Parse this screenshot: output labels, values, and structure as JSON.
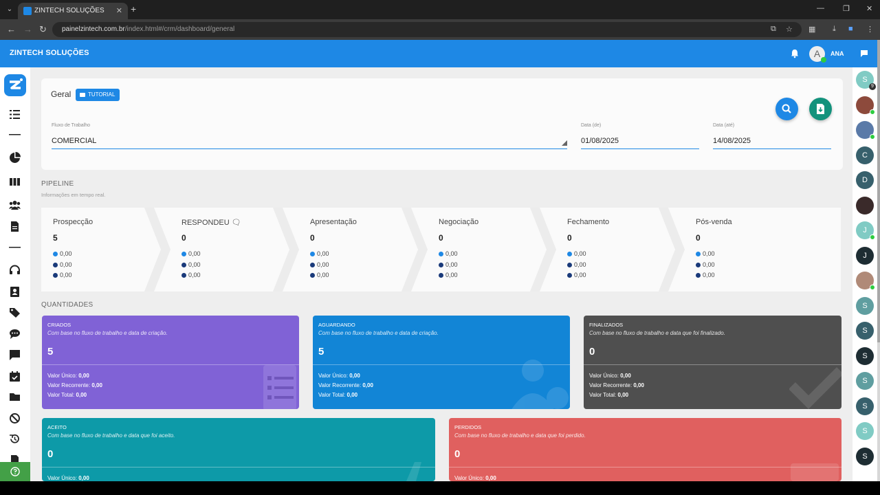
{
  "browser": {
    "tab_title": "ZINTECH SOLUÇÕES",
    "tab_close": "✕",
    "new_tab": "+",
    "url_host": "painelzintech.com.br",
    "url_path": "/index.html#/crm/dashboard/general"
  },
  "app": {
    "brand": "ZINTECH SOLUÇÕES",
    "user_initial": "A",
    "user_name": "ANA",
    "accent_color": "#1e88e5"
  },
  "sidebar_icons": [
    "tasks-icon",
    "divider",
    "pie-chart-icon",
    "kanban-icon",
    "users-icon",
    "document-icon",
    "divider",
    "headset-icon",
    "contacts-icon",
    "tags-icon",
    "chat-icon",
    "message-icon",
    "calendar-check-icon",
    "folder-icon",
    "block-icon",
    "history-icon",
    "file-icon"
  ],
  "filters": {
    "breadcrumb": "Geral",
    "tutorial_label": "TUTORIAL",
    "workflow_label": "Fluxo de Trabalho",
    "workflow_value": "COMERCIAL",
    "date_from_label": "Data (de)",
    "date_from_value": "01/08/2025",
    "date_to_label": "Data (até)",
    "date_to_value": "14/08/2025"
  },
  "pipeline": {
    "title": "PIPELINE",
    "subtitle": "Informações em tempo real.",
    "stages": [
      {
        "name": "Prospecção",
        "count": "5",
        "values": [
          "0,00",
          "0,00",
          "0,00"
        ]
      },
      {
        "name": "RESPONDEU 🗨",
        "count": "0",
        "values": [
          "0,00",
          "0,00",
          "0,00"
        ]
      },
      {
        "name": "Apresentação",
        "count": "0",
        "values": [
          "0,00",
          "0,00",
          "0,00"
        ]
      },
      {
        "name": "Negociação",
        "count": "0",
        "values": [
          "0,00",
          "0,00",
          "0,00"
        ]
      },
      {
        "name": "Fechamento",
        "count": "0",
        "values": [
          "0,00",
          "0,00",
          "0,00"
        ]
      },
      {
        "name": "Pós-venda",
        "count": "0",
        "values": [
          "0,00",
          "0,00",
          "0,00"
        ]
      }
    ],
    "dot_colors": [
      "#1e88e5",
      "#1a3a7a",
      "#1a3a7a"
    ]
  },
  "quantities": {
    "title": "QUANTIDADES",
    "cards": [
      {
        "title": "CRIADOS",
        "subtitle": "Com base no fluxo de trabalho e data de criação.",
        "count": "5",
        "unico_label": "Valor Único:",
        "unico": "0,00",
        "recorrente_label": "Valor Recorrente:",
        "recorrente": "0,00",
        "total_label": "Valor Total:",
        "total": "0,00",
        "color": "#8062d6"
      },
      {
        "title": "AGUARDANDO",
        "subtitle": "Com base no fluxo de trabalho e data de criação.",
        "count": "5",
        "unico_label": "Valor Único:",
        "unico": "0,00",
        "recorrente_label": "Valor Recorrente:",
        "recorrente": "0,00",
        "total_label": "Valor Total:",
        "total": "0,00",
        "color": "#1285d6"
      },
      {
        "title": "FINALIZADOS",
        "subtitle": "Com base no fluxo de trabalho e data que foi finalizado.",
        "count": "0",
        "unico_label": "Valor Único:",
        "unico": "0,00",
        "recorrente_label": "Valor Recorrente:",
        "recorrente": "0,00",
        "total_label": "Valor Total:",
        "total": "0,00",
        "color": "#4f4f4f"
      },
      {
        "title": "ACEITO",
        "subtitle": "Com base no fluxo de trabalho e data que foi aceito.",
        "count": "0",
        "unico_label": "Valor Único:",
        "unico": "0,00",
        "color": "#0d9aa8"
      },
      {
        "title": "PERDIDOS",
        "subtitle": "Com base no fluxo de trabalho e data que foi perdido.",
        "count": "0",
        "unico_label": "Valor Único:",
        "unico": "0,00",
        "color": "#e0605f"
      }
    ]
  },
  "contacts": [
    {
      "initial": "S",
      "color": "#80cbc4",
      "badge": "9"
    },
    {
      "initial": "",
      "color": "#8d4a3c",
      "online": true
    },
    {
      "initial": "",
      "color": "#5a7aa8",
      "online": true
    },
    {
      "initial": "C",
      "color": "#37606c"
    },
    {
      "initial": "D",
      "color": "#37606c"
    },
    {
      "initial": "",
      "color": "#3a2a2a"
    },
    {
      "initial": "J",
      "color": "#80cbc4",
      "online": true
    },
    {
      "initial": "J",
      "color": "#1e2d33"
    },
    {
      "initial": "",
      "color": "#b08a78",
      "online": true
    },
    {
      "initial": "S",
      "color": "#5f9ea0"
    },
    {
      "initial": "S",
      "color": "#37606c"
    },
    {
      "initial": "S",
      "color": "#1e2d33"
    },
    {
      "initial": "S",
      "color": "#5f9ea0"
    },
    {
      "initial": "S",
      "color": "#37606c"
    },
    {
      "initial": "S",
      "color": "#80cbc4"
    },
    {
      "initial": "S",
      "color": "#1e2d33"
    }
  ]
}
